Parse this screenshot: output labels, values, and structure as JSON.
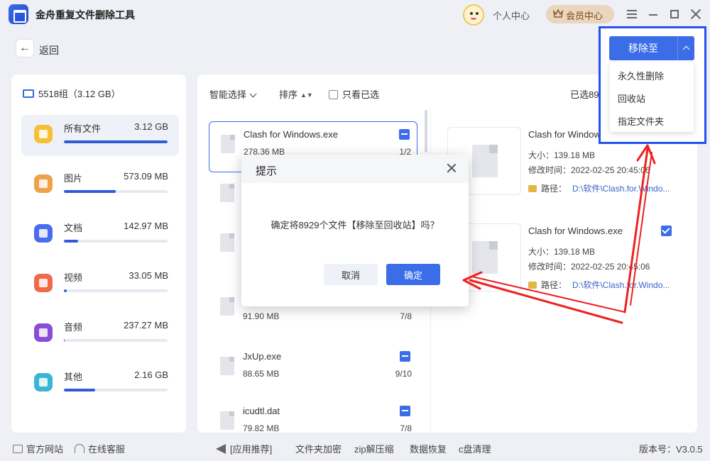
{
  "app": {
    "title": "金舟重复文件删除工具"
  },
  "header": {
    "personal_center": "个人中心",
    "vip_center": "会员中心"
  },
  "nav": {
    "back_label": "返回"
  },
  "left_panel": {
    "group_label": "5518组（3.12 GB）",
    "categories": [
      {
        "name": "所有文件",
        "size": "3.12 GB",
        "fill": 1.0,
        "color": "#f5c035"
      },
      {
        "name": "图片",
        "size": "573.09 MB",
        "fill": 0.5,
        "color": "#f0a24a"
      },
      {
        "name": "文档",
        "size": "142.97 MB",
        "fill": 0.14,
        "color": "#4a6cf0"
      },
      {
        "name": "视频",
        "size": "33.05 MB",
        "fill": 0.03,
        "color": "#f06a4a"
      },
      {
        "name": "音频",
        "size": "237.27 MB",
        "fill": 0.01,
        "color": "#8a4ed6"
      },
      {
        "name": "其他",
        "size": "2.16 GB",
        "fill": 0.3,
        "color": "#3bb5d6"
      }
    ]
  },
  "toolbar": {
    "smart_select": "智能选择",
    "sort": "排序",
    "only_checked": "只看已选",
    "selected_count": "已选8929"
  },
  "file_list": [
    {
      "name": "Clash for Windows.exe",
      "size": "278.36 MB",
      "index": "1/2",
      "checked": true
    },
    {
      "name": "",
      "size": "91.90 MB",
      "index": "7/8",
      "checked": false
    },
    {
      "name": "JxUp.exe",
      "size": "88.65 MB",
      "index": "9/10",
      "checked": true
    },
    {
      "name": "icudtl.dat",
      "size": "79.82 MB",
      "index": "7/8",
      "checked": true
    }
  ],
  "details": [
    {
      "name": "Clash for Windows.exe",
      "size": "大小：139.18 MB",
      "modified": "修改时间：2022-02-25 20:45:06",
      "path_label": "路径：",
      "path": "D:\\软件\\Clash.for.Windo...",
      "checked": false
    },
    {
      "name": "Clash for Windows.exe",
      "size": "大小：139.18 MB",
      "modified": "修改时间：2022-02-25 20:45:06",
      "path_label": "路径：",
      "path": "D:\\软件\\Clash.for.Windo...",
      "checked": true
    }
  ],
  "move_menu": {
    "button_label": "移除至",
    "items": [
      "永久性删除",
      "回收站",
      "指定文件夹"
    ]
  },
  "dialog": {
    "title": "提示",
    "message": "确定将8929个文件【移除至回收站】吗？",
    "cancel": "取消",
    "confirm": "确定"
  },
  "footer": {
    "website": "官方网站",
    "service": "在线客服",
    "recommend": "[应用推荐]",
    "links": [
      "文件夹加密",
      "zip解压缩",
      "数据恢复",
      "c盘清理"
    ],
    "version": "版本号：V3.0.5"
  },
  "colors": {
    "accent": "#3b6de8",
    "highlight": "#2451f0",
    "arrow": "#ee2020"
  }
}
